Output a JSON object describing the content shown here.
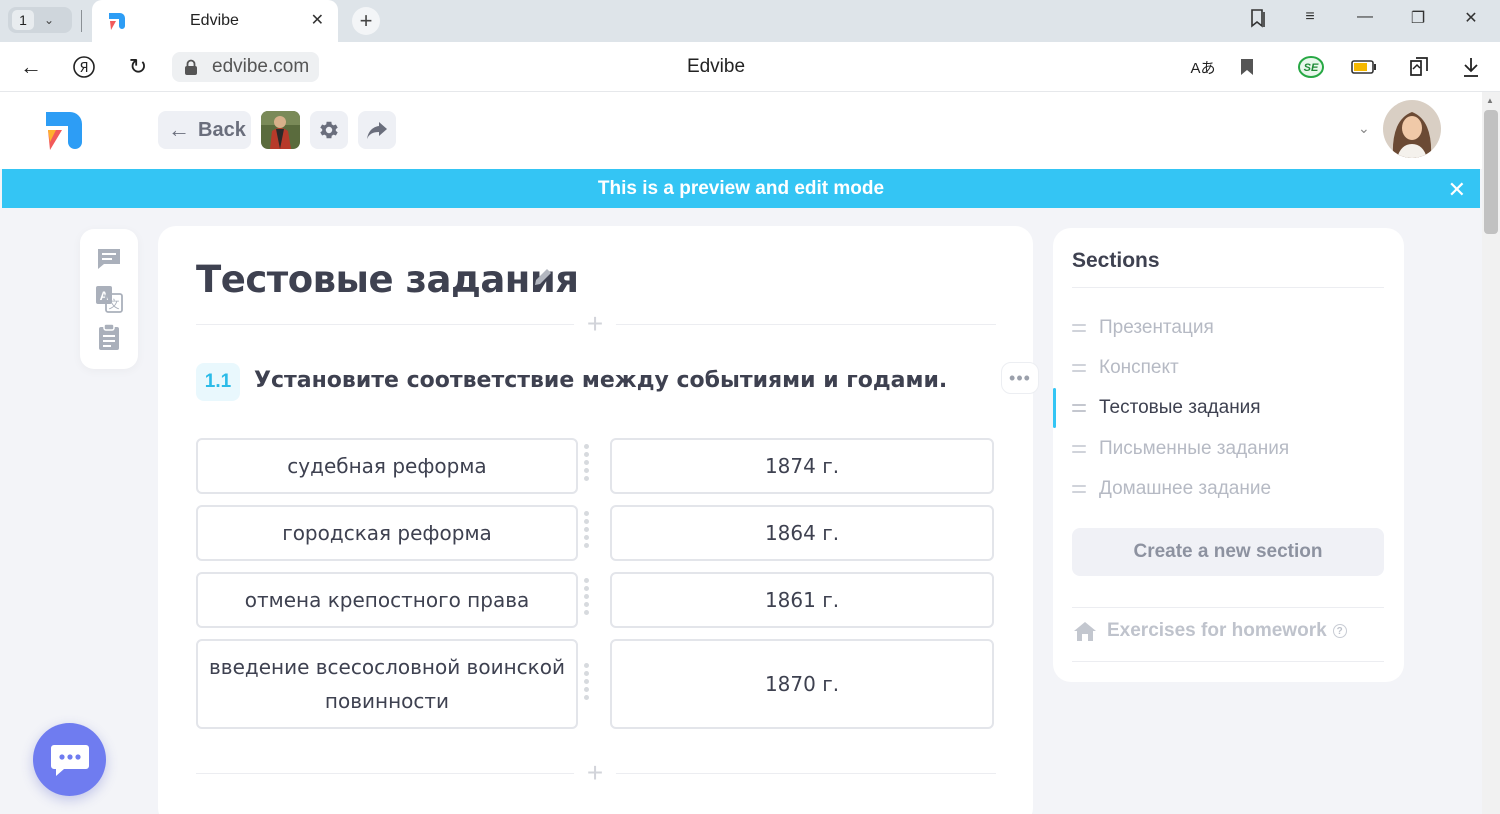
{
  "browser": {
    "tab_count": "1",
    "tab_title": "Edvibe",
    "url": "edvibe.com",
    "page_title": "Edvibe"
  },
  "header": {
    "back_label": "Back"
  },
  "banner": {
    "text": "This is a preview and edit mode"
  },
  "lesson": {
    "section_title": "Тестовые задания",
    "exercise": {
      "number": "1.1",
      "instruction": "Установите соответствие между событиями и годами.",
      "pairs": [
        {
          "event": "судебная реформа",
          "year": "1874 г."
        },
        {
          "event": "городская реформа",
          "year": "1864 г."
        },
        {
          "event": "отмена крепостного права",
          "year": "1861 г."
        },
        {
          "event": "введение всесословной воинской повинности",
          "year": "1870 г."
        }
      ]
    }
  },
  "sidebar": {
    "title": "Sections",
    "items": [
      {
        "label": "Презентация",
        "active": false
      },
      {
        "label": "Конспект",
        "active": false
      },
      {
        "label": "Тестовые задания",
        "active": true
      },
      {
        "label": "Письменные задания",
        "active": false
      },
      {
        "label": "Домашнее задание",
        "active": false
      }
    ],
    "create_label": "Create a new section",
    "homework_label": "Exercises for homework"
  },
  "colors": {
    "accent": "#34c5f4",
    "chat": "#6f7cf0"
  },
  "icons": {
    "tools": [
      "comment-icon",
      "translate-icon",
      "clipboard-icon"
    ],
    "header": [
      "settings-icon",
      "share-icon"
    ]
  }
}
